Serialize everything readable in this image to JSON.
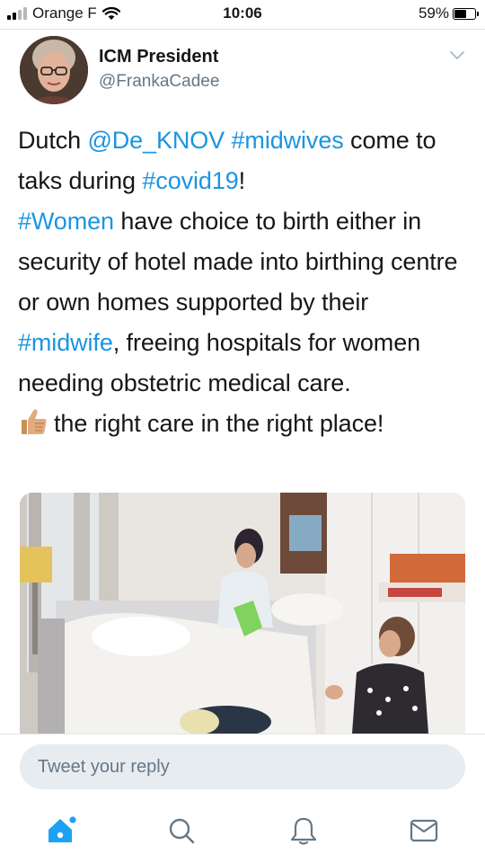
{
  "status_bar": {
    "carrier": "Orange F",
    "time": "10:06",
    "battery_percent": "59%",
    "battery_level": 0.59,
    "signal_bars": 2,
    "icons": [
      "signal-icon",
      "wifi-icon",
      "battery-icon"
    ]
  },
  "tweet": {
    "author_name": "ICM President",
    "author_handle": "@FrankaCadee",
    "text": {
      "t1": "Dutch ",
      "l1": "@De_KNOV",
      "t2": " ",
      "l2": "#midwives",
      "t3": " come to taks during ",
      "l3": "#covid19",
      "t4": "!",
      "l4": "#Women",
      "t5": " have choice to birth either in security of hotel made into birthing centre or own homes supported by their ",
      "l5": "#midwife",
      "t6": ", freeing hospitals for women needing obstetric medical care.",
      "t7": "the right care in the right place!"
    },
    "emoji": "thumbs-up-icon",
    "link_color": "#1b95e0"
  },
  "reply": {
    "placeholder": "Tweet your reply"
  },
  "tab_bar": {
    "items": [
      "home-icon",
      "search-icon",
      "notifications-icon",
      "messages-icon"
    ],
    "active_color": "#1da1f2"
  }
}
